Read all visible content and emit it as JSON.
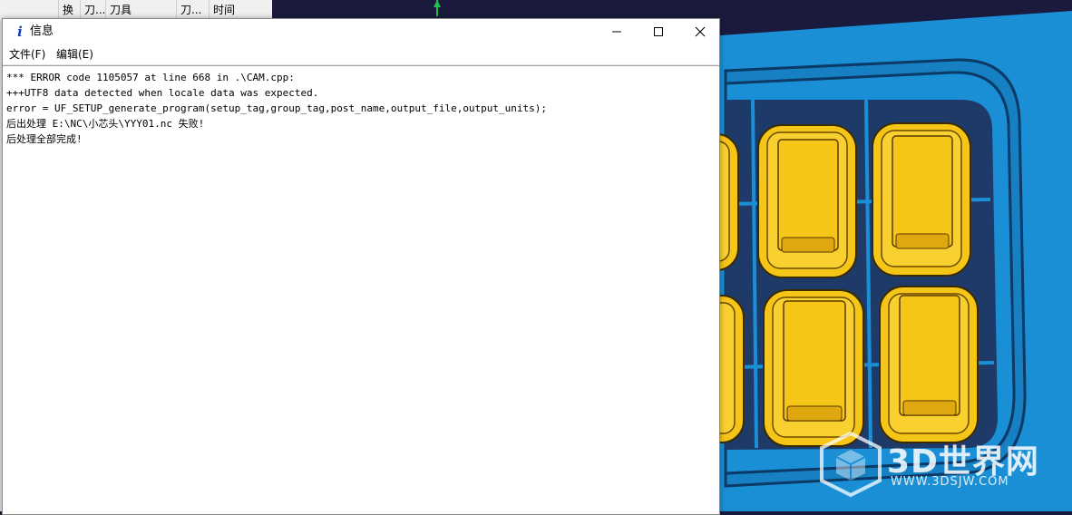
{
  "background_table": {
    "columns": [
      "换",
      "刀...",
      "刀具",
      "刀...",
      "时间"
    ]
  },
  "dialog": {
    "icon": "info-i-icon",
    "title": "信息",
    "controls": {
      "minimize": "minimize-icon",
      "maximize": "maximize-icon",
      "close": "close-icon"
    },
    "menu": [
      {
        "label": "文件(F)"
      },
      {
        "label": "编辑(E)"
      }
    ],
    "lines": [
      "*** ERROR code 1105057 at line 668 in .\\CAM.cpp:",
      "+++UTF8 data detected when locale data was expected.",
      "error = UF_SETUP_generate_program(setup_tag,group_tag,post_name,output_file,output_units);",
      "后出处理 E:\\NC\\小芯头\\YYY01.nc 失败!",
      "后处理全部完成!"
    ]
  },
  "watermark": {
    "brand": "3D世界网",
    "url": "WWW.3DSJW.COM"
  },
  "colors": {
    "viewport_blue": "#1a8fd6",
    "part_yellow": "#f5c518",
    "dark_band": "#1a1a3e"
  }
}
